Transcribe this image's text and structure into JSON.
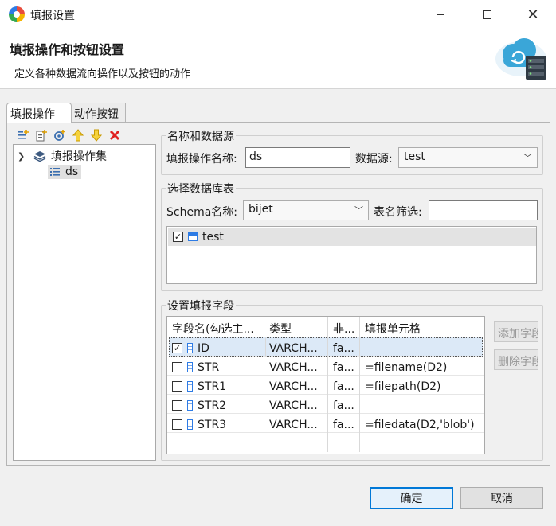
{
  "window": {
    "title": "填报设置"
  },
  "header": {
    "title": "填报操作和按钮设置",
    "description": "定义各种数据流向操作以及按钮的动作"
  },
  "tabs": [
    {
      "label": "填报操作"
    },
    {
      "label": "动作按钮"
    }
  ],
  "toolbar": {
    "icons": [
      "add-icon",
      "add-sub-icon",
      "link-icon",
      "move-up-icon",
      "move-down-icon",
      "delete-icon"
    ]
  },
  "tree": {
    "root_label": "填报操作集",
    "child_label": "ds"
  },
  "name_source": {
    "group_label": "名称和数据源",
    "name_label": "填报操作名称:",
    "name_value": "ds",
    "source_label": "数据源:",
    "source_value": "test"
  },
  "db_table": {
    "group_label": "选择数据库表",
    "schema_label": "Schema名称:",
    "schema_value": "bijet",
    "filter_label": "表名筛选:",
    "filter_value": "",
    "tables": [
      {
        "name": "test",
        "checked": true
      }
    ]
  },
  "fields": {
    "group_label": "设置填报字段",
    "columns": [
      "字段名(勾选主...",
      "类型",
      "非...",
      "填报单元格"
    ],
    "rows": [
      {
        "name": "ID",
        "type": "VARCH...",
        "nonnull": "fa...",
        "cell": "",
        "checked": true
      },
      {
        "name": "STR",
        "type": "VARCH...",
        "nonnull": "fa...",
        "cell": "=filename(D2)",
        "checked": false
      },
      {
        "name": "STR1",
        "type": "VARCH...",
        "nonnull": "fa...",
        "cell": "=filepath(D2)",
        "checked": false
      },
      {
        "name": "STR2",
        "type": "VARCH...",
        "nonnull": "fa...",
        "cell": "",
        "checked": false
      },
      {
        "name": "STR3",
        "type": "VARCH...",
        "nonnull": "fa...",
        "cell": "=filedata(D2,'blob')",
        "checked": false
      }
    ],
    "add_button": "添加字段",
    "delete_button": "删除字段"
  },
  "footer": {
    "ok": "确定",
    "cancel": "取消"
  }
}
